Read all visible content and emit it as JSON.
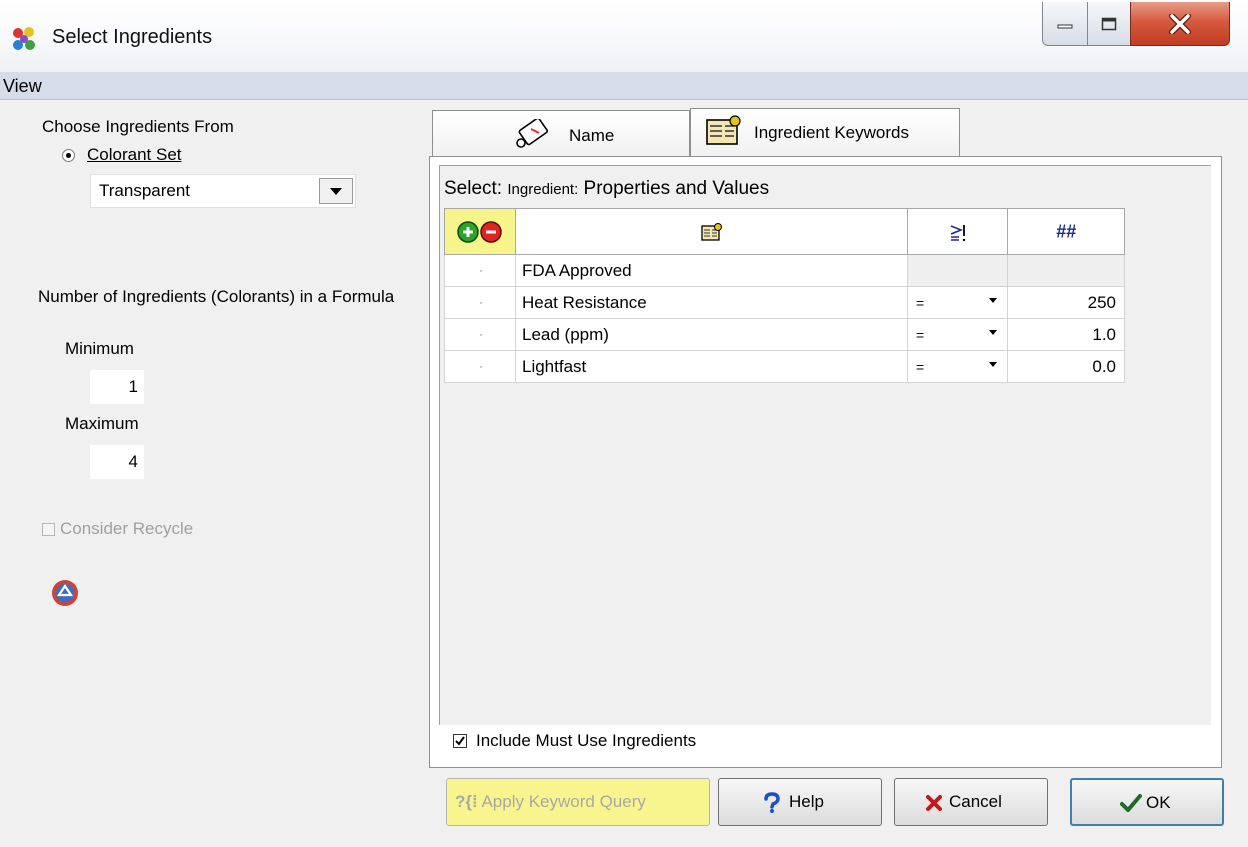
{
  "window": {
    "title": "Select Ingredients",
    "icon": "colorant-app-icon",
    "controls": [
      "minimize-icon",
      "maximize-icon",
      "close-icon"
    ]
  },
  "menu": {
    "items": [
      "View"
    ]
  },
  "left_panel": {
    "choose_label": "Choose Ingredients From",
    "colorant_set_label": "Colorant Set",
    "colorant_set_value": "Transparent",
    "number_label": "Number of Ingredients (Colorants) in a Formula",
    "minimum_label": "Minimum",
    "minimum_value": "1",
    "maximum_label": "Maximum",
    "maximum_value": "4",
    "consider_recycle_label": "Consider Recycle",
    "consider_recycle_checked": false,
    "recycle_icon": "recycle-icon"
  },
  "tabs": [
    {
      "label": "Name",
      "icon": "name-tag-icon",
      "active": false
    },
    {
      "label": "Ingredient Keywords",
      "icon": "keywords-icon",
      "active": true
    }
  ],
  "grid": {
    "title_select": "Select:",
    "title_ingredient": "Ingredient:",
    "title_props": "Properties and Values",
    "header_icons": [
      "add-remove-icon",
      "keyword-icon",
      "operator-icon",
      "value-icon"
    ],
    "header_value_label": "##",
    "rows": [
      {
        "property": "FDA Approved",
        "operator": "",
        "value": ""
      },
      {
        "property": "Heat Resistance",
        "operator": "=",
        "value": "250"
      },
      {
        "property": "Lead (ppm)",
        "operator": "=",
        "value": "1.0"
      },
      {
        "property": "Lightfast",
        "operator": "=",
        "value": "0.0"
      }
    ]
  },
  "include_must_use": {
    "label": "Include Must Use Ingredients",
    "checked": true
  },
  "buttons": {
    "apply": "Apply Keyword Query",
    "help": "Help",
    "cancel": "Cancel",
    "ok": "OK"
  },
  "colors": {
    "highlight": "#f8f58e",
    "menu_bg": "#d5dde8",
    "close_red": "#c13c22",
    "ok_border": "#3c7fb1"
  }
}
